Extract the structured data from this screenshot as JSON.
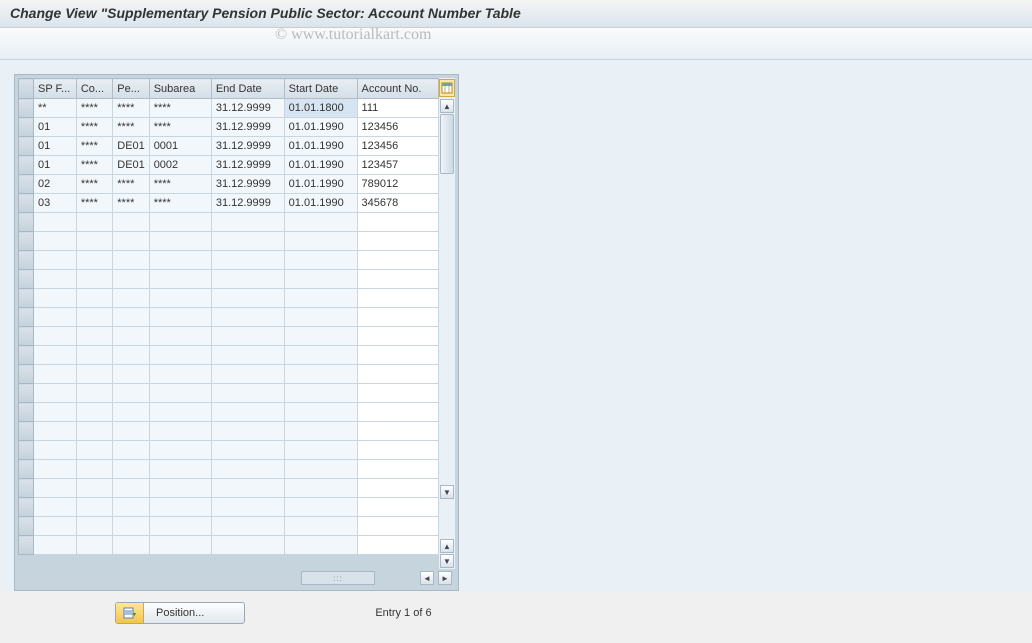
{
  "header": {
    "title": "Change View \"Supplementary Pension Public Sector: Account Number Table"
  },
  "watermark": "© www.tutorialkart.com",
  "table": {
    "columns": {
      "sp": "SP F...",
      "co": "Co...",
      "pe": "Pe...",
      "subarea": "Subarea",
      "end_date": "End Date",
      "start_date": "Start Date",
      "account": "Account No."
    },
    "rows": [
      {
        "sp": "**",
        "co": "****",
        "pe": "****",
        "subarea": "****",
        "end_date": "31.12.9999",
        "start_date": "01.01.1800",
        "account": "111"
      },
      {
        "sp": "01",
        "co": "****",
        "pe": "****",
        "subarea": "****",
        "end_date": "31.12.9999",
        "start_date": "01.01.1990",
        "account": "123456"
      },
      {
        "sp": "01",
        "co": "****",
        "pe": "DE01",
        "subarea": "0001",
        "end_date": "31.12.9999",
        "start_date": "01.01.1990",
        "account": "123456"
      },
      {
        "sp": "01",
        "co": "****",
        "pe": "DE01",
        "subarea": "0002",
        "end_date": "31.12.9999",
        "start_date": "01.01.1990",
        "account": "123457"
      },
      {
        "sp": "02",
        "co": "****",
        "pe": "****",
        "subarea": "****",
        "end_date": "31.12.9999",
        "start_date": "01.01.1990",
        "account": "789012"
      },
      {
        "sp": "03",
        "co": "****",
        "pe": "****",
        "subarea": "****",
        "end_date": "31.12.9999",
        "start_date": "01.01.1990",
        "account": "345678"
      }
    ],
    "empty_rows": 18
  },
  "footer": {
    "position_label": "Position...",
    "entry_text": "Entry 1 of 6"
  }
}
